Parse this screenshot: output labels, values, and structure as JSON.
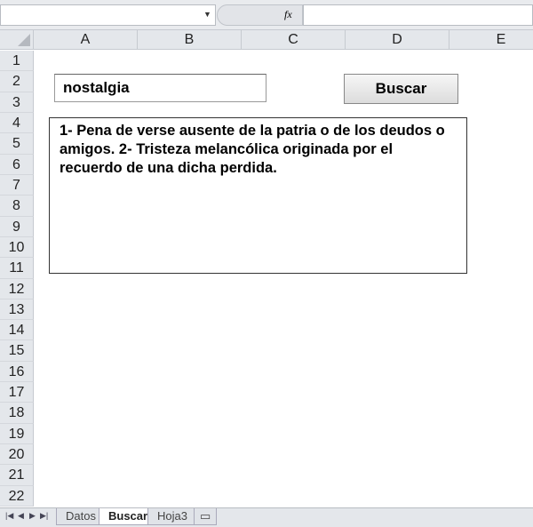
{
  "formula_bar": {
    "name_box": "",
    "fx_label": "fx",
    "formula": ""
  },
  "columns": [
    "A",
    "B",
    "C",
    "D",
    "E"
  ],
  "rows": [
    "1",
    "2",
    "3",
    "4",
    "5",
    "6",
    "7",
    "8",
    "9",
    "10",
    "11",
    "12",
    "13",
    "14",
    "15",
    "16",
    "17",
    "18",
    "19",
    "20",
    "21",
    "22"
  ],
  "form": {
    "search_value": "nostalgia",
    "button_label": "Buscar",
    "definition": "1-  Pena de verse ausente de la patria o de los deudos o amigos. 2-  Tristeza melancólica originada por el recuerdo de una dicha perdida."
  },
  "sheet_tabs": [
    {
      "label": "Datos"
    },
    {
      "label": "Buscar",
      "active": true
    },
    {
      "label": "Hoja3"
    }
  ],
  "tab_nav": [
    "first",
    "prev",
    "next",
    "last"
  ]
}
